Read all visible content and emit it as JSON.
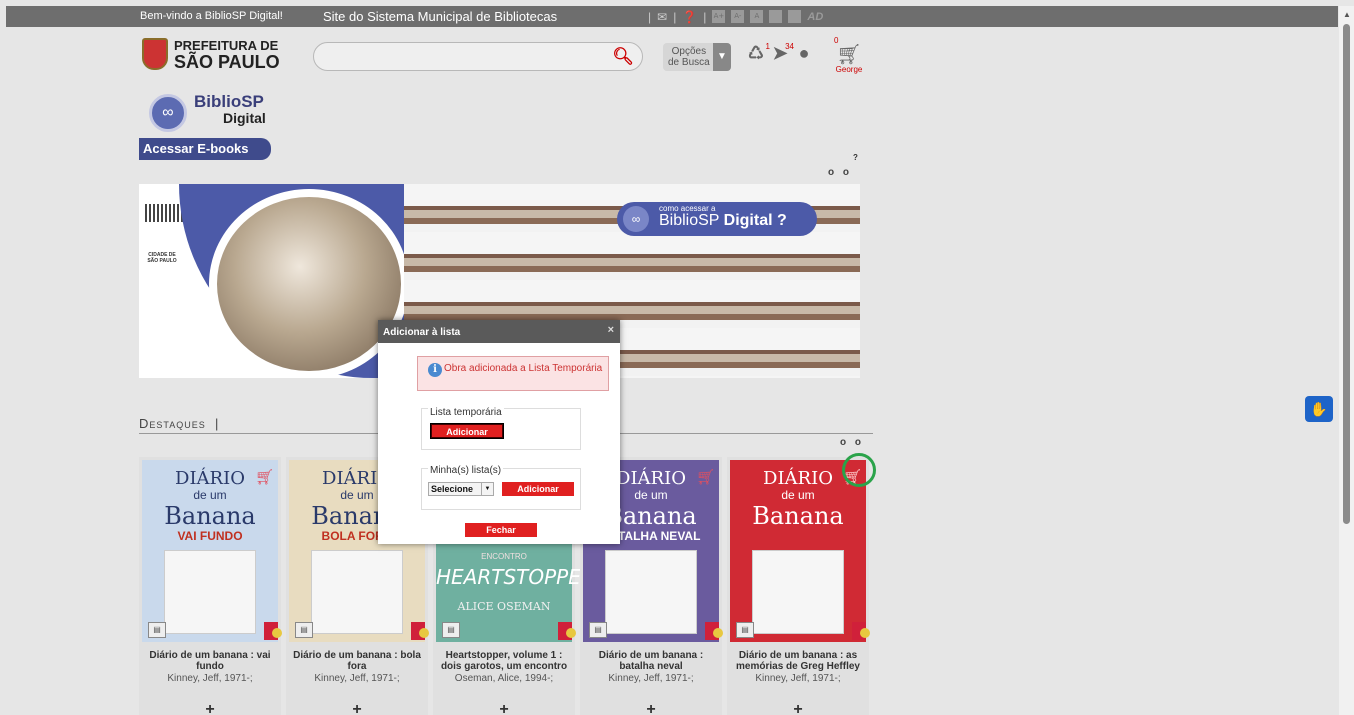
{
  "topbar": {
    "welcome": "Bem-vindo a BiblioSP Digital!",
    "site_link": "Site do Sistema Municipal de Bibliotecas",
    "icon_names": [
      "mail-icon",
      "help-icon",
      "font-increase-icon",
      "font-decrease-icon",
      "font-normal-icon",
      "contrast-icon",
      "contrast-alt-icon",
      "ad-logo"
    ],
    "ad_text": "AD"
  },
  "header": {
    "logo_line1": "PREFEITURA DE",
    "logo_line2": "SÃO PAULO",
    "search_value": "",
    "options_label_1": "Opções",
    "options_label_2": "de Busca",
    "notif_count_1": "1",
    "notif_count_2": "34",
    "cart_count": "0",
    "user_name": "George"
  },
  "bibliosp": {
    "title": "BiblioSP",
    "subtitle": "Digital",
    "button": "Acessar E-books"
  },
  "banner": {
    "help_mark": "?",
    "pager": "o o",
    "pill_small": "como acessar a",
    "pill_big_1": "BiblioSP",
    "pill_big_2": "Digital",
    "pill_q": "?",
    "cidade": "CIDADE DE SÃO PAULO"
  },
  "destaques": {
    "title": "Destaques",
    "divider": "|",
    "pager": "o o",
    "books": [
      {
        "title": "Diário de um banana : vai fundo",
        "author": "Kinney, Jeff, 1971-;",
        "cover_top": "DIÁRIO",
        "cover_sub": "de um",
        "cover_main": "Banana",
        "cover_band": "VAI FUNDO"
      },
      {
        "title": "Diário de um banana : bola fora",
        "author": "Kinney, Jeff, 1971-;",
        "cover_top": "DIÁRIO",
        "cover_sub": "de um",
        "cover_main": "Banana",
        "cover_band": "BOLA FORA"
      },
      {
        "title": "Heartstopper, volume 1 : dois garotos, um encontro",
        "author": "Oseman, Alice, 1994-;",
        "cover_top": "HEARTSTOPPER",
        "cover_sub": "ENCONTRO",
        "cover_main": "ALICE OSEMAN",
        "cover_band": ""
      },
      {
        "title": "Diário de um banana : batalha neval",
        "author": "Kinney, Jeff, 1971-;",
        "cover_top": "DIÁRIO",
        "cover_sub": "de um",
        "cover_main": "Banana",
        "cover_band": "BATALHA NEVAL"
      },
      {
        "title": "Diário de um banana : as memórias de Greg Heffley",
        "author": "Kinney, Jeff, 1971-;",
        "cover_top": "DIÁRIO",
        "cover_sub": "de um",
        "cover_main": "Banana",
        "cover_band": ""
      }
    ],
    "plus": "+"
  },
  "modal": {
    "title": "Adicionar à lista",
    "close": "×",
    "alert": "Obra adicionada a Lista Temporária",
    "temp_label": "Lista temporária",
    "temp_button": "Adicionar",
    "my_lists_label": "Minha(s) lista(s)",
    "select_value": "Selecione",
    "my_lists_button": "Adicionar",
    "close_button": "Fechar"
  },
  "colors": {
    "accent_red": "#e02020",
    "topbar": "#6e6e6e",
    "brand_blue": "#4c5aa8",
    "highlight_ring": "#2aa34a"
  }
}
